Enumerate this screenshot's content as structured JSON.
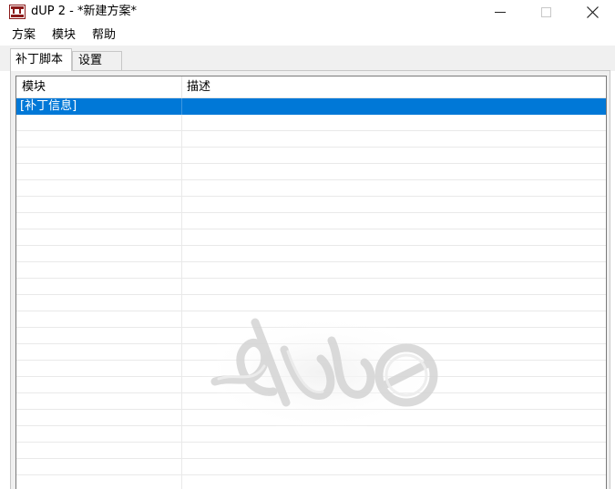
{
  "window": {
    "title": "dUP 2 - *新建方案*"
  },
  "menubar": {
    "items": [
      "方案",
      "模块",
      "帮助"
    ]
  },
  "tabs": [
    {
      "label": "补丁脚本",
      "active": true
    },
    {
      "label": "设置",
      "active": false
    }
  ],
  "listview": {
    "columns": [
      "模块",
      "描述"
    ],
    "rows": [
      {
        "module": "[补丁信息]",
        "description": "",
        "selected": true
      }
    ]
  },
  "colors": {
    "selection": "#0078d7",
    "app_icon": "#8b1a1a",
    "panel_background": "#f0f0f0"
  },
  "icons": {
    "app": "dup-app-icon",
    "minimize": "minimize-icon",
    "maximize": "maximize-icon",
    "close": "close-icon",
    "watermark": "dup-graffiti-logo-watermark"
  }
}
